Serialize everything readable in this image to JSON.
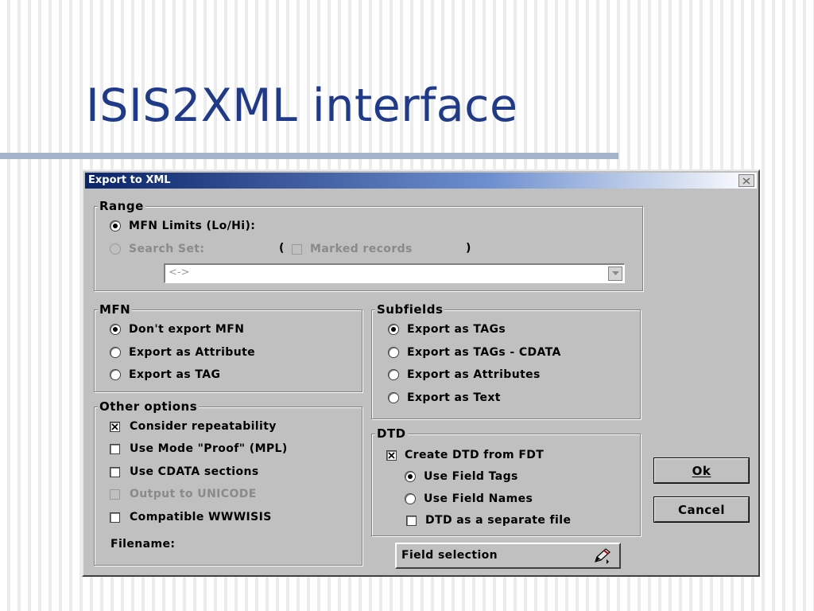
{
  "slide": {
    "title": "ISIS2XML interface"
  },
  "dialog": {
    "title": "Export to XML",
    "range": {
      "legend": "Range",
      "mfn_limits": "MFN Limits (Lo/Hi):",
      "search_set": "Search Set:",
      "open_paren": "(",
      "marked_records": "Marked records",
      "close_paren": ")",
      "search_combo_value": "<->"
    },
    "mfn": {
      "legend": "MFN",
      "options": [
        "Don't export MFN",
        "Export as Attribute",
        "Export as TAG"
      ]
    },
    "subfields": {
      "legend": "Subfields",
      "options": [
        "Export as TAGs",
        "Export as TAGs - CDATA",
        "Export as Attributes",
        "Export as Text"
      ]
    },
    "other": {
      "legend": "Other options",
      "consider_repeatability": "Consider repeatability",
      "use_mode_proof": "Use Mode \"Proof\" (MPL)",
      "use_cdata": "Use CDATA sections",
      "output_unicode": "Output to UNICODE",
      "compatible_wwwisis": "Compatible WWWISIS",
      "filename_label": "Filename:"
    },
    "dtd": {
      "legend": "DTD",
      "create_dtd": "Create DTD from FDT",
      "use_field_tags": "Use Field Tags",
      "use_field_names": "Use Field Names",
      "separate_file": "DTD as a separate file"
    },
    "buttons": {
      "ok": "Ok",
      "cancel": "Cancel",
      "field_selection": "Field selection"
    }
  }
}
